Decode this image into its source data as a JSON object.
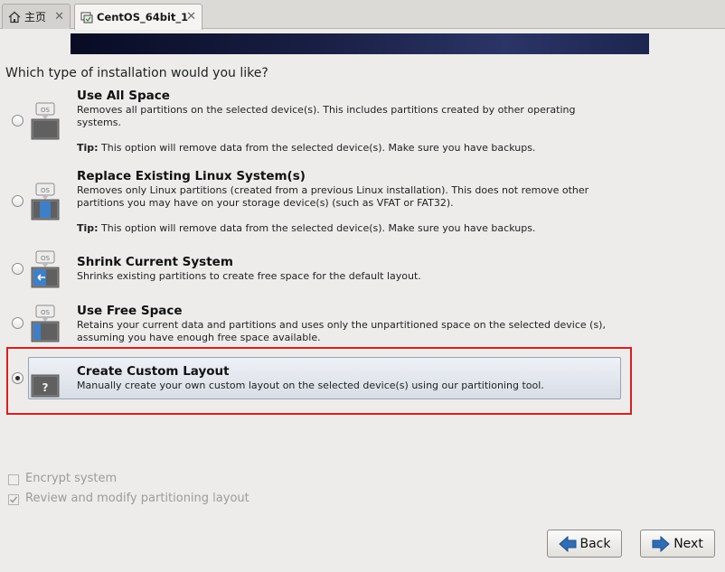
{
  "tabs": [
    {
      "label": "主页",
      "icon": "home-icon"
    },
    {
      "label": "CentOS_64bit_1",
      "icon": "vm-icon",
      "close": "✕"
    }
  ],
  "home_tab_close": "✕",
  "question": "Which type of installation would you like?",
  "options": [
    {
      "title": "Use All Space",
      "desc": "Removes all partitions on the selected device(s).  This includes partitions created by other operating systems.",
      "tip_label": "Tip:",
      "tip": "This option will remove data from the selected device(s).  Make sure you have backups.",
      "icon_badge": "OS",
      "selected": false
    },
    {
      "title": "Replace Existing Linux System(s)",
      "desc": "Removes only Linux partitions (created from a previous Linux installation).  This does not remove other partitions you may have on your storage device(s) (such as VFAT or FAT32).",
      "tip_label": "Tip:",
      "tip": "This option will remove data from the selected device(s).  Make sure you have backups.",
      "icon_badge": "OS",
      "selected": false
    },
    {
      "title": "Shrink Current System",
      "desc": "Shrinks existing partitions to create free space for the default layout.",
      "icon_badge": "OS",
      "selected": false
    },
    {
      "title": "Use Free Space",
      "desc": "Retains your current data and partitions and uses only the unpartitioned space on the selected device (s), assuming you have enough free space available.",
      "icon_badge": "OS",
      "selected": false
    },
    {
      "title": "Create Custom Layout",
      "desc": "Manually create your own custom layout on the selected device(s) using our partitioning tool.",
      "icon_badge": "?",
      "selected": true
    }
  ],
  "encrypt_label": "Encrypt system",
  "review_label": "Review and modify partitioning layout",
  "review_checked": true,
  "encrypt_checked": false,
  "buttons": {
    "back": "Back",
    "next": "Next"
  },
  "colors": {
    "highlight_frame": "#d81e1e",
    "arrow_blue": "#2f6db5"
  }
}
